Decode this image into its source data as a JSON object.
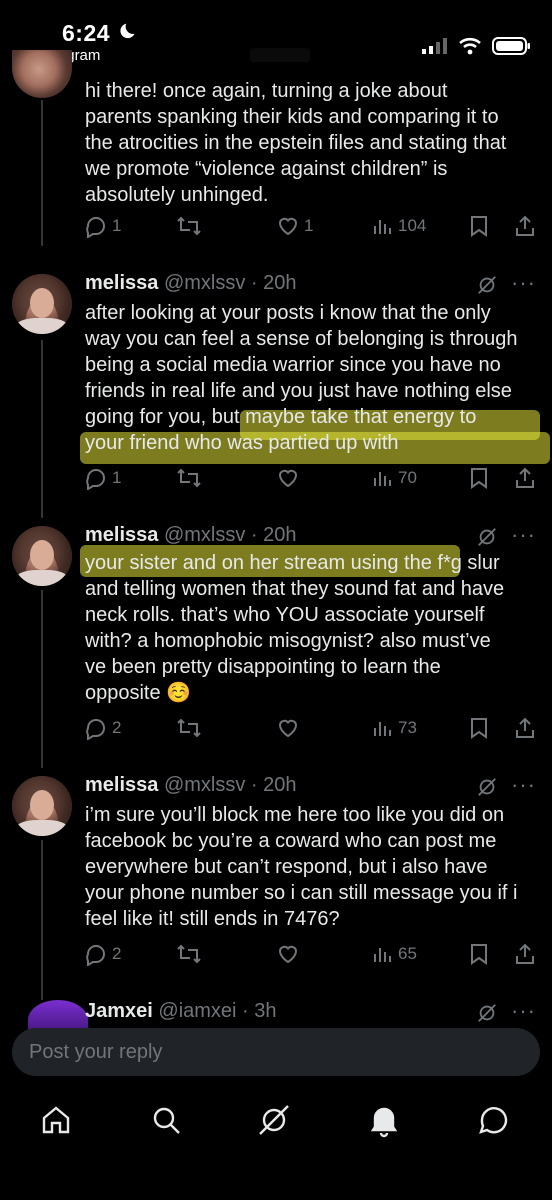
{
  "status": {
    "time": "6:24",
    "back_app": "◀ Instagram"
  },
  "posts": [
    {
      "text": "hi there! once again, turning a joke about\nparents spanking their kids and comparing it to\nthe atrocities in the epstein files and stating that\nwe promote “violence against children” is\nabsolutely unhinged.",
      "replies": "1",
      "reposts": "",
      "likes": "1",
      "views": "104"
    },
    {
      "name": "melissa",
      "handle": "@mxlssv · 20h",
      "text": "after looking at your posts i know that the only\nway you can feel a sense of belonging is through\nbeing a social media warrior since you have no\nfriends in real life and you just have nothing else\ngoing for you, but maybe take that energy to\nyour friend who was partied up with",
      "replies": "1",
      "reposts": "",
      "likes": "",
      "views": "70"
    },
    {
      "name": "melissa",
      "handle": "@mxlssv · 20h",
      "text": "your sister and on her stream using the f*g slur\nand telling women that they sound fat and have\nneck rolls. that’s who YOU associate yourself\nwith? a homophobic misogynist? also must’ve\nve been pretty disappointing to learn the\nopposite ☺️",
      "replies": "2",
      "reposts": "",
      "likes": "",
      "views": "73"
    },
    {
      "name": "melissa",
      "handle": "@mxlssv · 20h",
      "text": "i’m sure you’ll block me here too like you did on\nfacebook bc you’re a coward who can post me\neverywhere but can’t respond, but i also have\nyour phone number so i can still message you if i\nfeel like it! still ends in 7476?",
      "replies": "2",
      "reposts": "",
      "likes": "",
      "views": "65"
    },
    {
      "name": "Jamxei",
      "handle": "@iamxei · 3h"
    }
  ],
  "reply_placeholder": "Post your reply",
  "more_label": "···",
  "highlight_color": "#e4e33a",
  "icons": {
    "reply": "reply-icon",
    "repost": "repost-icon",
    "like": "like-icon",
    "views": "views-icon",
    "bookmark": "bookmark-icon",
    "share": "share-icon",
    "grok": "grok-icon"
  },
  "tabs": [
    "home-icon",
    "search-icon",
    "grok-icon",
    "notifications-icon",
    "messages-icon"
  ]
}
